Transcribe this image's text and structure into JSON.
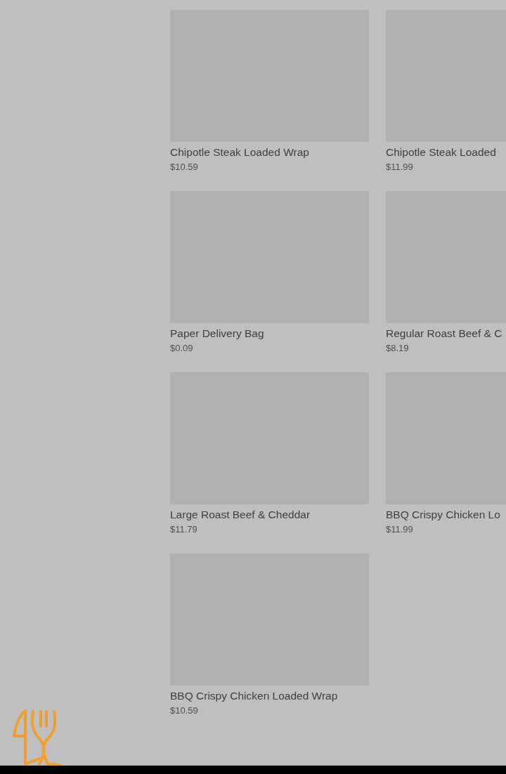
{
  "products": [
    {
      "name": "Chipotle Steak Loaded Wrap",
      "price": "$10.59"
    },
    {
      "name": "Chipotle Steak Loaded",
      "price": "$11.99"
    },
    {
      "name": "Paper Delivery Bag",
      "price": "$0.09"
    },
    {
      "name": "Regular Roast Beef & C",
      "price": "$8.19"
    },
    {
      "name": "Large Roast Beef & Cheddar",
      "price": "$11.79"
    },
    {
      "name": "BBQ Crispy Chicken Lo",
      "price": "$11.99"
    },
    {
      "name": "BBQ Crispy Chicken Loaded Wrap",
      "price": "$10.59"
    }
  ]
}
